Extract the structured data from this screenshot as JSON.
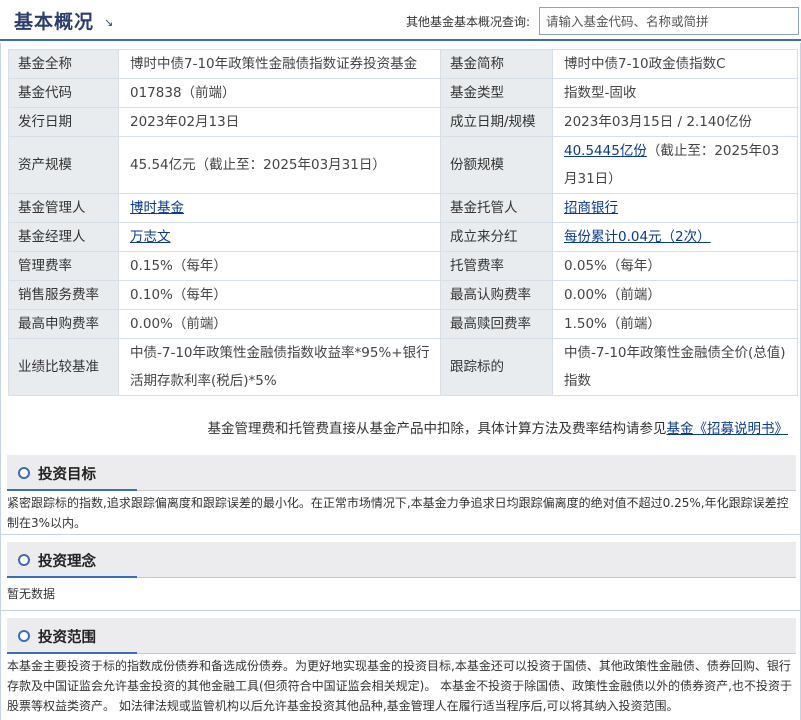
{
  "header": {
    "title": "基本概况",
    "title_icon": "arrow-down-right-icon",
    "search_label": "其他基金基本概况查询:",
    "search_placeholder": "请输入基金代码、名称或简拼"
  },
  "info": {
    "rows": [
      {
        "l1": "基金全称",
        "v1": "博时中债7-10年政策性金融债指数证券投资基金",
        "l2": "基金简称",
        "v2": "博时中债7-10政金债指数C"
      },
      {
        "l1": "基金代码",
        "v1": "017838（前端）",
        "l2": "基金类型",
        "v2": "指数型-固收"
      },
      {
        "l1": "发行日期",
        "v1": "2023年02月13日",
        "l2": "成立日期/规模",
        "v2": "2023年03月15日 / 2.140亿份"
      },
      {
        "l1": "资产规模",
        "v1": "45.54亿元（截止至：2025年03月31日）",
        "l2": "份额规模",
        "v2_link": "40.5445亿份",
        "v2_rest": "（截止至：2025年03月31日）"
      },
      {
        "l1": "基金管理人",
        "v1_link": "博时基金",
        "l2": "基金托管人",
        "v2_link": "招商银行"
      },
      {
        "l1": "基金经理人",
        "v1_link": "万志文",
        "l2": "成立来分红",
        "v2_link": "每份累计0.04元（2次）"
      },
      {
        "l1": "管理费率",
        "v1": "0.15%（每年）",
        "l2": "托管费率",
        "v2": "0.05%（每年）"
      },
      {
        "l1": "销售服务费率",
        "v1": "0.10%（每年）",
        "l2": "最高认购费率",
        "v2": "0.00%（前端）"
      },
      {
        "l1": "最高申购费率",
        "v1": "0.00%（前端）",
        "l2": "最高赎回费率",
        "v2": "1.50%（前端）"
      },
      {
        "l1": "业绩比较基准",
        "v1": "中债-7-10年政策性金融债指数收益率*95%+银行活期存款利率(税后)*5%",
        "l2": "跟踪标的",
        "v2": "中债-7-10年政策性金融债全价(总值)指数"
      }
    ],
    "fee_note_text": "基金管理费和托管费直接从基金产品中扣除，具体计算方法及费率结构请参见",
    "fee_note_link": "基金《招募说明书》"
  },
  "sections": [
    {
      "icon": "circle-bullet-icon",
      "title": "投资目标",
      "body": "紧密跟踪标的指数,追求跟踪偏离度和跟踪误差的最小化。在正常市场情况下,本基金力争追求日均跟踪偏离度的绝对值不超过0.25%,年化跟踪误差控制在3%以内。"
    },
    {
      "icon": "circle-bullet-icon",
      "title": "投资理念",
      "body": "暂无数据"
    },
    {
      "icon": "circle-bullet-icon",
      "title": "投资范围",
      "body": "本基金主要投资于标的指数成份债券和备选成份债券。为更好地实现基金的投资目标,本基金还可以投资于国债、其他政策性金融债、债券回购、银行存款及中国证监会允许基金投资的其他金融工具(但须符合中国证监会相关规定)。 本基金不投资于除国债、政策性金融债以外的债券资产,也不投资于股票等权益类资产。 如法律法规或监管机构以后允许基金投资其他品种,基金管理人在履行适当程序后,可以将其纳入投资范围。"
    }
  ],
  "colors": {
    "accent": "#3d6db5",
    "link": "#0b3a8f",
    "label_bg": "#e9ecef",
    "title": "#2a3f6e"
  }
}
